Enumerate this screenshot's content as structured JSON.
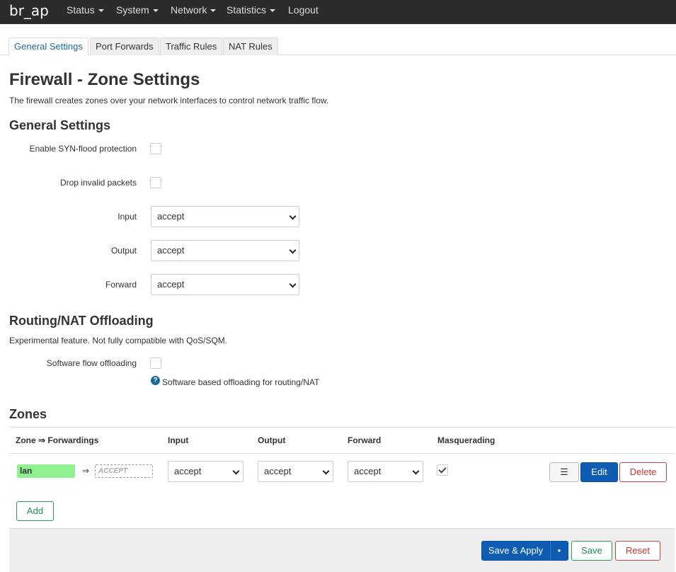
{
  "nav": {
    "brand": "br_ap",
    "items": [
      {
        "label": "Status",
        "dropdown": true
      },
      {
        "label": "System",
        "dropdown": true
      },
      {
        "label": "Network",
        "dropdown": true
      },
      {
        "label": "Statistics",
        "dropdown": true
      },
      {
        "label": "Logout",
        "dropdown": false
      }
    ]
  },
  "tabs": [
    "General Settings",
    "Port Forwards",
    "Traffic Rules",
    "NAT Rules"
  ],
  "active_tab": "General Settings",
  "page": {
    "title": "Firewall - Zone Settings",
    "description": "The firewall creates zones over your network interfaces to control network traffic flow."
  },
  "general": {
    "heading": "General Settings",
    "syn_flood_label": "Enable SYN-flood protection",
    "syn_flood_checked": false,
    "drop_invalid_label": "Drop invalid packets",
    "drop_invalid_checked": false,
    "input_label": "Input",
    "input_value": "accept",
    "output_label": "Output",
    "output_value": "accept",
    "forward_label": "Forward",
    "forward_value": "accept"
  },
  "offloading": {
    "heading": "Routing/NAT Offloading",
    "description": "Experimental feature. Not fully compatible with QoS/SQM.",
    "sw_flow_label": "Software flow offloading",
    "sw_flow_checked": false,
    "help_glyph": "?",
    "help_text": "Software based offloading for routing/NAT"
  },
  "zones": {
    "heading": "Zones",
    "columns": [
      "Zone ⇒ Forwardings",
      "Input",
      "Output",
      "Forward",
      "Masquerading"
    ],
    "rows": [
      {
        "zone": "lan",
        "zone_color": "#90f090",
        "arrow": "⇒",
        "forward_target": "ACCEPT",
        "input": "accept",
        "output": "accept",
        "forward": "accept",
        "masquerading": true
      }
    ],
    "row_buttons": {
      "menu": "☰",
      "edit": "Edit",
      "delete": "Delete"
    },
    "add_label": "Add"
  },
  "footer": {
    "save_apply": "Save & Apply",
    "save_apply_dropdown": "•",
    "save": "Save",
    "reset": "Reset"
  },
  "colors": {
    "primary": "#0e5db3",
    "positive": "#1f8a4f",
    "negative": "#cc3333",
    "topbar": "#2b2b2b"
  }
}
